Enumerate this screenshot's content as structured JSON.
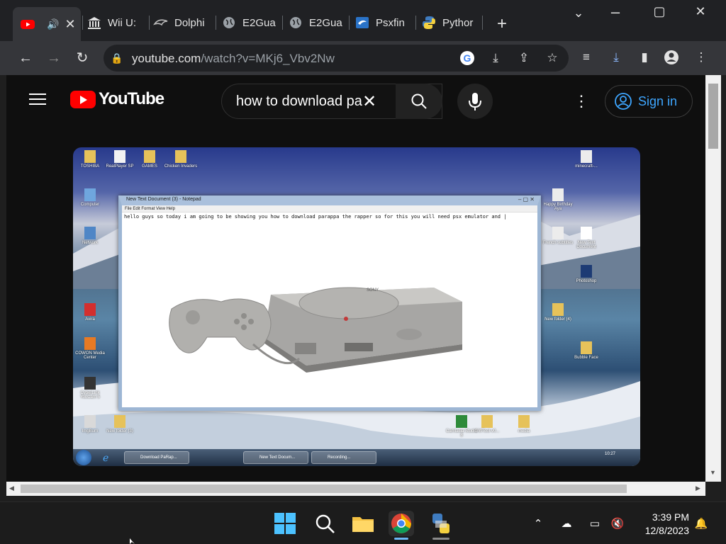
{
  "tabs": [
    {
      "label": "",
      "favicon": "youtube-icon",
      "active": true
    },
    {
      "label": "Wii U:",
      "favicon": "building-icon"
    },
    {
      "label": "Dolphi",
      "favicon": "dolphin-icon"
    },
    {
      "label": "E2Gua",
      "favicon": "globe-icon"
    },
    {
      "label": "E2Gua",
      "favicon": "globe-icon"
    },
    {
      "label": "Psxfin",
      "favicon": "psx-icon"
    },
    {
      "label": "Pythor",
      "favicon": "python-icon"
    }
  ],
  "toolbar": {
    "url_host": "youtube.com",
    "url_path": "/watch?v=MKj6_Vbv2Nw"
  },
  "youtube": {
    "logo_text": "YouTube",
    "search_value": "how to download pa",
    "signin_label": "Sign in"
  },
  "video": {
    "desktop_icons": [
      "TOSHIBA",
      "RealPlayer SP",
      "GAMES",
      "Chicken Invaders",
      "Computer",
      "Network",
      "Avira",
      "COWON Media Center",
      "CyberLink YouCam 5",
      "ImgBurn",
      "New folder (3)",
      "minecraft-...",
      "Happy Birthday Aya",
      "French subtitles",
      "New Text Document",
      "New folder (4)",
      "Photoshop",
      "Bubble Face",
      "GWTool-v0...",
      "media",
      "Camtasia Studio 8"
    ],
    "notepad_title": "New Text Document (3) - Notepad",
    "notepad_menu": "File   Edit   Format   View   Help",
    "notepad_text": "hello guys so today i am going to be showing you how to download parappa the rapper so for this you will need psx emulator and |",
    "taskbar_items": [
      "Download PaRap...",
      "New Text Docum...",
      "Recording..."
    ],
    "time": "10:27"
  },
  "taskbar": {
    "time": "3:39 PM",
    "date": "12/8/2023"
  },
  "colors": {
    "yt_red": "#ff0000",
    "link_blue": "#3ea6ff",
    "chrome_dark": "#202124"
  }
}
